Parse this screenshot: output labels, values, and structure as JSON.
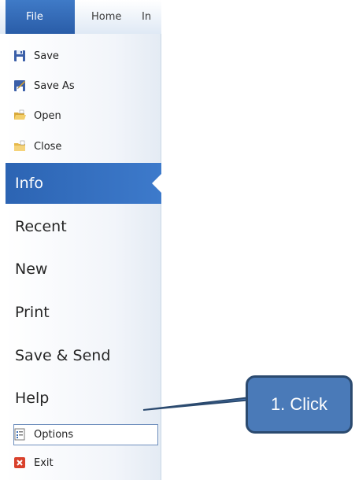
{
  "ribbon": {
    "tabs": [
      {
        "label": "File"
      },
      {
        "label": "Home"
      },
      {
        "label": "In"
      }
    ]
  },
  "backstage": {
    "quick_commands": [
      {
        "label": "Save",
        "icon": "save-icon"
      },
      {
        "label": "Save As",
        "icon": "save-as-icon"
      },
      {
        "label": "Open",
        "icon": "open-folder-icon"
      },
      {
        "label": "Close",
        "icon": "close-folder-icon"
      }
    ],
    "tabs": [
      {
        "label": "Info",
        "active": true
      },
      {
        "label": "Recent"
      },
      {
        "label": "New"
      },
      {
        "label": "Print"
      },
      {
        "label": "Save & Send"
      },
      {
        "label": "Help"
      }
    ],
    "bottom_commands": [
      {
        "label": "Options",
        "icon": "options-icon",
        "highlighted": true
      },
      {
        "label": "Exit",
        "icon": "exit-icon"
      }
    ]
  },
  "annotation": {
    "callout_text": "1. Click"
  },
  "colors": {
    "accent_blue": "#2c64b3",
    "callout_fill": "#4a7ab8",
    "callout_border": "#2b4a6f"
  }
}
